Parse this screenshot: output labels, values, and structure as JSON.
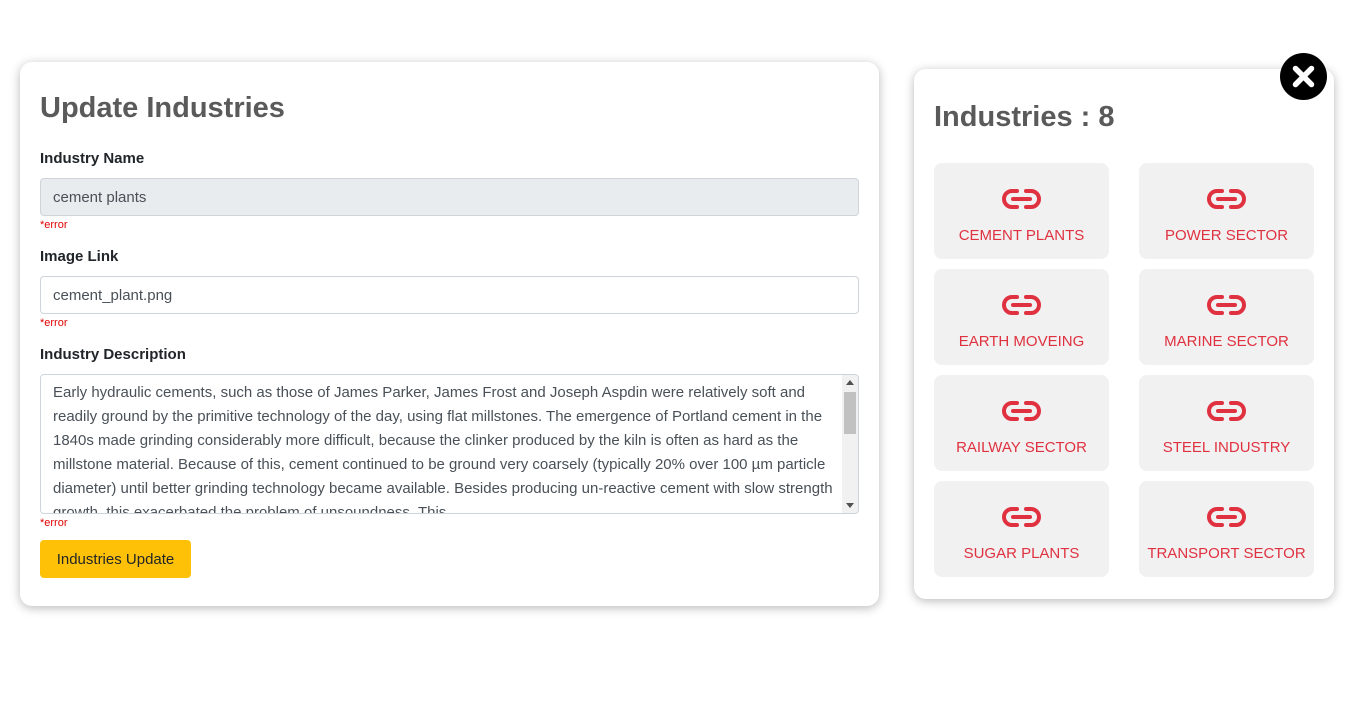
{
  "update_form": {
    "title": "Update Industries",
    "name_label": "Industry Name",
    "name_value": "cement plants",
    "image_label": "Image Link",
    "image_value": "cement_plant.png",
    "description_label": "Industry Description",
    "description_value": "Early hydraulic cements, such as those of James Parker, James Frost and Joseph Aspdin were relatively soft and readily ground by the primitive technology of the day, using flat millstones. The emergence of Portland cement in the 1840s made grinding considerably more difficult, because the clinker produced by the kiln is often as hard as the millstone material. Because of this, cement continued to be ground very coarsely (typically 20% over 100 µm particle diameter) until better grinding technology became available. Besides producing un-reactive cement with slow strength growth, this exacerbated the problem of unsoundness. This",
    "error_text": "*error",
    "submit_label": "Industries Update"
  },
  "industries_panel": {
    "heading": "Industries : 8",
    "accent_color": "#e03140",
    "tile_icon": "link-icon",
    "close_icon": "close-icon",
    "items": [
      {
        "label": "CEMENT PLANTS"
      },
      {
        "label": "POWER SECTOR"
      },
      {
        "label": "EARTH MOVEING"
      },
      {
        "label": "MARINE SECTOR"
      },
      {
        "label": "RAILWAY SECTOR"
      },
      {
        "label": "STEEL INDUSTRY"
      },
      {
        "label": "SUGAR PLANTS"
      },
      {
        "label": "TRANSPORT SECTOR"
      }
    ]
  }
}
